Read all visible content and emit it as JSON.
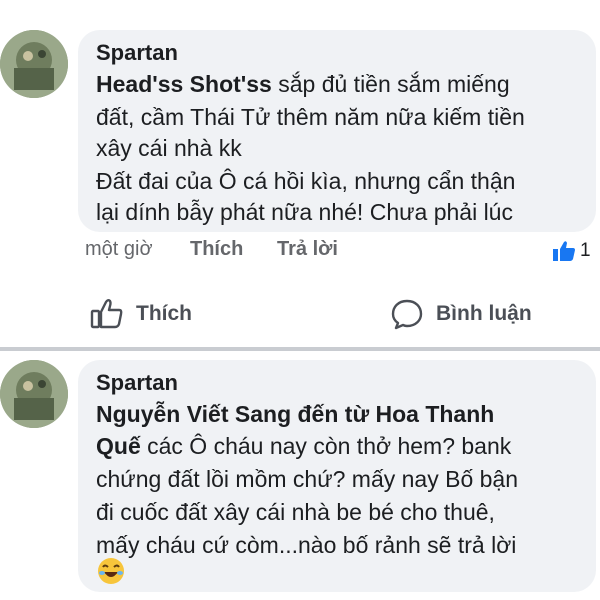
{
  "posts": [
    {
      "author": "Spartan",
      "mention": "Head'ss Shot'ss",
      "lines": [
        "  sắp đủ tiền sắm miếng",
        "đất, cầm Thái Tử thêm năm nữa kiếm tiền",
        "xây cái nhà kk",
        "Đất đai của Ô cá hồi kìa, nhưng cẩn thận",
        "lại dính bẫy phát nữa nhé! Chưa phải lúc"
      ],
      "time": "một giờ",
      "like_label": "Thích",
      "reply_label": "Trả lời",
      "reaction_count": "1"
    },
    {
      "author": "Spartan",
      "mention": "Nguyễn Viết Sang đến từ Hoa Thanh",
      "mention_cont": "Quế",
      "lines": [
        "  các Ô cháu nay còn thở hem? bank",
        "chứng đất lồi mồm chứ? mấy nay Bố bận",
        "đi cuốc đất xây cái nhà be bé cho thuê,",
        "mấy cháu cứ còm...nào bố rảnh sẽ trả lời"
      ]
    }
  ],
  "actions": {
    "like": "Thích",
    "comment": "Bình luận"
  },
  "colors": {
    "bubble": "#f0f2f5",
    "accent": "#1877f2",
    "meta": "#65676b"
  },
  "icons": [
    "like-outline-icon",
    "comment-bubble-icon",
    "thumbs-up-reaction-icon",
    "laughing-emoji-icon"
  ]
}
